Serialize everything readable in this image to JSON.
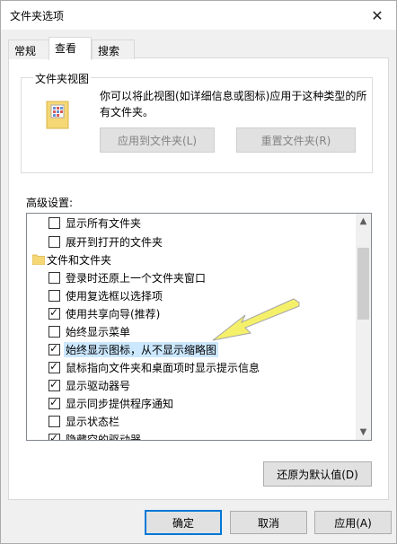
{
  "window": {
    "title": "文件夹选项",
    "close_label": "✕"
  },
  "tabs": [
    {
      "label": "常规"
    },
    {
      "label": "查看"
    },
    {
      "label": "搜索"
    }
  ],
  "folder_views": {
    "group_label": "文件夹视图",
    "description": "你可以将此视图(如详细信息或图标)应用于这种类型的所有文件夹。",
    "apply_button": "应用到文件夹(L)",
    "reset_button": "重置文件夹(R)"
  },
  "advanced": {
    "label": "高级设置:",
    "items": [
      {
        "type": "checkbox",
        "label": "显示所有文件夹",
        "checked": false
      },
      {
        "type": "checkbox",
        "label": "展开到打开的文件夹",
        "checked": false
      },
      {
        "type": "folder",
        "label": "文件和文件夹"
      },
      {
        "type": "checkbox",
        "label": "登录时还原上一个文件夹窗口",
        "checked": false
      },
      {
        "type": "checkbox",
        "label": "使用复选框以选择项",
        "checked": false
      },
      {
        "type": "checkbox",
        "label": "使用共享向导(推荐)",
        "checked": true
      },
      {
        "type": "checkbox",
        "label": "始终显示菜单",
        "checked": false
      },
      {
        "type": "checkbox",
        "label": "始终显示图标，从不显示缩略图",
        "checked": true,
        "selected": true
      },
      {
        "type": "checkbox",
        "label": "鼠标指向文件夹和桌面项时显示提示信息",
        "checked": true
      },
      {
        "type": "checkbox",
        "label": "显示驱动器号",
        "checked": true
      },
      {
        "type": "checkbox",
        "label": "显示同步提供程序通知",
        "checked": true
      },
      {
        "type": "checkbox",
        "label": "显示状态栏",
        "checked": false
      },
      {
        "type": "checkbox",
        "label": "隐藏空的驱动器",
        "checked": true
      }
    ]
  },
  "restore_defaults": "还原为默认值(D)",
  "footer": {
    "ok": "确定",
    "cancel": "取消",
    "apply": "应用(A)"
  },
  "colors": {
    "accent": "#0078d7",
    "selection": "#cce8ff",
    "arrow": "#f5f06a"
  }
}
